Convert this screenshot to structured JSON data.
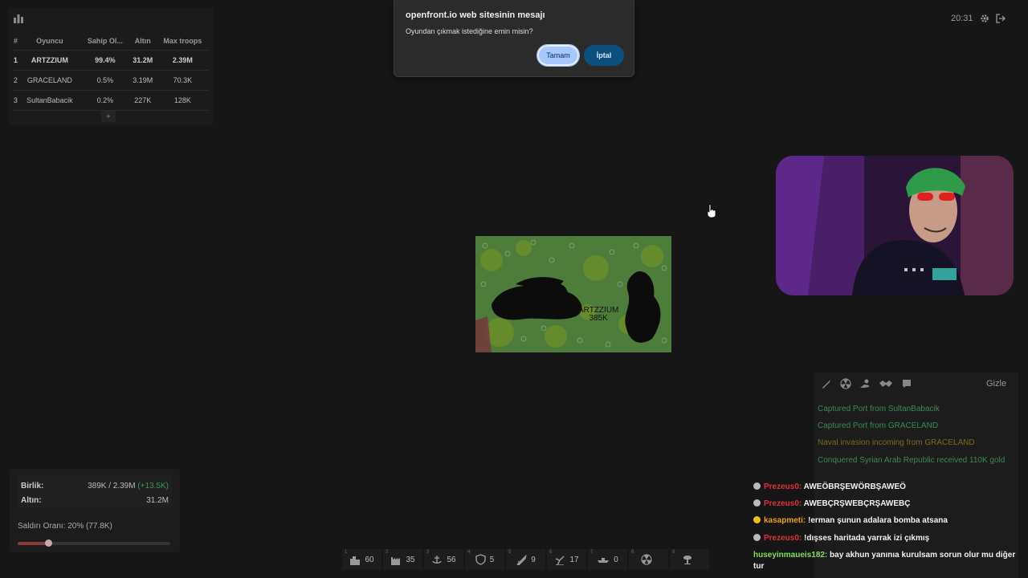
{
  "leaderboard": {
    "headers": [
      "#",
      "Oyuncu",
      "Sahip Ol...",
      "Altın",
      "Max troops"
    ],
    "rows": [
      {
        "rank": "1",
        "player": "ARTZZIUM",
        "owned": "99.4%",
        "gold": "31.2M",
        "troops": "2.39M"
      },
      {
        "rank": "2",
        "player": "GRACELAND",
        "owned": "0.5%",
        "gold": "3.19M",
        "troops": "70.3K"
      },
      {
        "rank": "3",
        "player": "SultanBabacik",
        "owned": "0.2%",
        "gold": "227K",
        "troops": "128K"
      }
    ],
    "expand_label": "+"
  },
  "top_right": {
    "time": "20:31"
  },
  "dialog": {
    "title": "openfront.io web sitesinin mesajı",
    "message": "Oyundan çıkmak istediğine emin misin?",
    "ok_label": "Tamam",
    "cancel_label": "İptal"
  },
  "map": {
    "player_label": "ARTZZIUM",
    "player_troops": "385K"
  },
  "events": {
    "hide_label": "Gizle",
    "items": [
      {
        "text": "Captured Port from SultanBabacik",
        "color": "#3f8a4e"
      },
      {
        "text": "Captured Port from GRACELAND",
        "color": "#3f8a4e"
      },
      {
        "text": "Naval invasion incoming from GRACELAND",
        "color": "#7a6a22"
      },
      {
        "text": "Conquered Syrian Arab Republic received 110K gold",
        "color": "#3f8a4e"
      }
    ]
  },
  "stats": {
    "troops_label": "Birlik:",
    "troops_value": "389K / 2.39M",
    "troops_delta": "(+13.5K)",
    "gold_label": "Altın:",
    "gold_value": "31.2M",
    "attack_label": "Saldırı Oranı: 20% (77.8K)",
    "attack_ratio": 0.2
  },
  "build_bar": [
    {
      "key": "1",
      "icon": "city-icon",
      "count": "60"
    },
    {
      "key": "2",
      "icon": "factory-icon",
      "count": "35"
    },
    {
      "key": "3",
      "icon": "port-icon",
      "count": "56"
    },
    {
      "key": "4",
      "icon": "defense-post-icon",
      "count": "5"
    },
    {
      "key": "5",
      "icon": "missile-silo-icon",
      "count": "9"
    },
    {
      "key": "6",
      "icon": "sam-launcher-icon",
      "count": "17"
    },
    {
      "key": "7",
      "icon": "warship-icon",
      "count": "0"
    },
    {
      "key": "8",
      "icon": "atom-bomb-icon",
      "count": ""
    },
    {
      "key": "9",
      "icon": "hydrogen-bomb-icon",
      "count": ""
    }
  ],
  "chat": [
    {
      "user": "Prezeus0:",
      "message": "AWEÖBRŞEWÖRBŞAWEÖ",
      "user_color": "#e0303a",
      "badge": "#bbbbbb"
    },
    {
      "user": "Prezeus0:",
      "message": "AWEBÇRŞWEBÇRŞAWEBÇ",
      "user_color": "#e0303a",
      "badge": "#bbbbbb"
    },
    {
      "user": "kasapmeti:",
      "message": "!erman şunun adalara bomba atsana",
      "user_color": "#e8a020",
      "badge": "#e8c020"
    },
    {
      "user": "Prezeus0:",
      "message": "!dışses haritada yarrak izi çıkmış",
      "user_color": "#e0303a",
      "badge": "#bbbbbb"
    },
    {
      "user": "huseyinmaueis182:",
      "message": "bay akhun yanınıa kurulsam sorun olur mu diğer tur",
      "user_color": "#7ee05a",
      "badge": ""
    }
  ],
  "colors": {
    "accent": "#a8c7fa",
    "cancel": "#0b4f7f",
    "troop_delta": "#3a9a4a"
  }
}
